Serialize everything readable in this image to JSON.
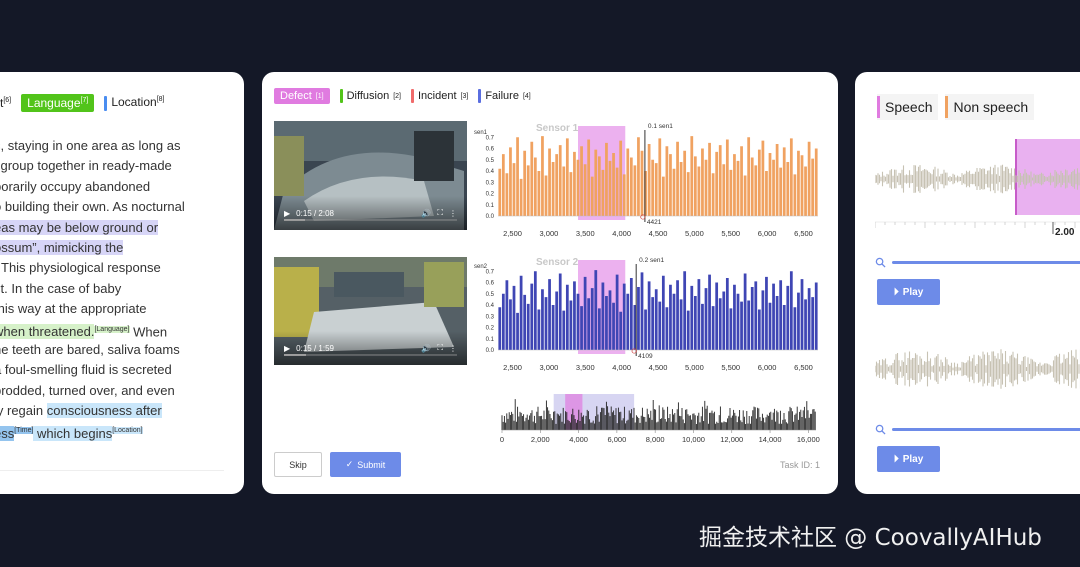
{
  "left_card": {
    "labels": [
      {
        "text": "ct",
        "sup": "[6]",
        "color": "#ffffff",
        "style": "plain"
      },
      {
        "text": "Language",
        "sup": "[7]",
        "color": "#52c41a",
        "style": "pill"
      },
      {
        "text": "Location",
        "sup": "[8]",
        "color": "#4a8df0",
        "style": "bar"
      }
    ],
    "lines": [
      [
        {
          "t": "c, staying in one area as long as"
        }
      ],
      [
        {
          "t": "l group together in ready-made"
        }
      ],
      [
        {
          "t": "porarily occupy abandoned"
        }
      ],
      [
        {
          "t": "o building their own. As nocturnal"
        }
      ],
      [
        {
          "t": "eas may be below ground or",
          "hl": "purple"
        }
      ],
      [
        {
          "t": "ossum”, mimicking the",
          "hl": "purple"
        }
      ],
      [
        {
          "t": "]",
          "hl": "purple"
        },
        {
          "t": "  This physiological response"
        }
      ],
      [
        {
          "t": "ct. In the case of baby"
        }
      ],
      [
        {
          "t": " this way at the appropriate"
        }
      ],
      [
        {
          "t": " when threatened.",
          "hl": "green"
        },
        {
          "t": "[Language]",
          "hl": "green",
          "sup": true
        },
        {
          "t": " When"
        }
      ],
      [
        {
          "t": "he teeth are bared, saliva foams"
        }
      ],
      [
        {
          "t": "a foul-smelling fluid is secreted"
        }
      ],
      [
        {
          "t": "prodded, turned over, and even"
        }
      ],
      [
        {
          "t": "ly regain "
        },
        {
          "t": "consciousness after",
          "hl": "blue"
        }
      ],
      [
        {
          "t": "ess",
          "hl": "blue-dark"
        },
        {
          "t": "[Time]",
          "hl": "blue-dark",
          "sup": true
        },
        {
          "t": " which begins",
          "hl": "blue"
        },
        {
          "t": "[Location]",
          "hl": "blue",
          "sup": true
        }
      ]
    ]
  },
  "middle_card": {
    "labels": [
      {
        "text": "Defect",
        "sup": "[1]",
        "color": "#e07be0"
      },
      {
        "text": "Diffusion",
        "sup": "[2]",
        "color": "#52c41a"
      },
      {
        "text": "Incident",
        "sup": "[3]",
        "color": "#f06b6b"
      },
      {
        "text": "Failure",
        "sup": "[4]",
        "color": "#5a6ee0"
      }
    ],
    "videos": [
      {
        "time": "0:15 / 2:08",
        "progress": 0.12
      },
      {
        "time": "0:15 / 1:59",
        "progress": 0.13
      }
    ],
    "skip_label": "Skip",
    "submit_label": "Submit",
    "task_id": "Task ID: 1"
  },
  "chart_data": [
    {
      "type": "bar",
      "title": "Sensor 1",
      "ylabel": "sen1",
      "color": "#f0a261",
      "xlim": [
        2300,
        6700
      ],
      "ylim": [
        0,
        0.8
      ],
      "yticks": [
        0.0,
        0.1,
        0.2,
        0.3,
        0.4,
        0.5,
        0.6,
        0.7
      ],
      "xticks": [
        2500,
        3000,
        3500,
        4000,
        4500,
        5000,
        5500,
        6000,
        6500
      ],
      "region": {
        "start": 3400,
        "end": 4050,
        "color": "#e9a3ec"
      },
      "marker": {
        "x": 4320,
        "label": "0.1 sen1",
        "value_label": "4421"
      },
      "values": [
        0.42,
        0.55,
        0.38,
        0.61,
        0.47,
        0.7,
        0.33,
        0.58,
        0.45,
        0.66,
        0.52,
        0.4,
        0.71,
        0.36,
        0.6,
        0.48,
        0.55,
        0.63,
        0.44,
        0.69,
        0.39,
        0.57,
        0.5,
        0.62,
        0.46,
        0.68,
        0.35,
        0.59,
        0.53,
        0.41,
        0.65,
        0.49,
        0.56,
        0.43,
        0.67,
        0.37,
        0.6,
        0.52,
        0.45,
        0.7,
        0.58,
        0.4,
        0.64,
        0.5,
        0.47,
        0.69,
        0.35,
        0.62,
        0.55,
        0.42,
        0.66,
        0.48,
        0.58,
        0.39,
        0.71,
        0.53,
        0.44,
        0.6,
        0.5,
        0.65,
        0.38,
        0.57,
        0.63,
        0.46,
        0.68,
        0.41,
        0.55,
        0.49,
        0.62,
        0.36,
        0.7,
        0.52,
        0.45,
        0.59,
        0.67,
        0.4,
        0.56,
        0.5,
        0.64,
        0.43,
        0.61,
        0.48,
        0.69,
        0.37,
        0.58,
        0.54,
        0.44,
        0.66,
        0.51,
        0.6
      ]
    },
    {
      "type": "bar",
      "title": "Sensor 2",
      "ylabel": "sen2",
      "color": "#3f46b4",
      "xlim": [
        2300,
        6700
      ],
      "ylim": [
        0,
        0.8
      ],
      "yticks": [
        0.0,
        0.1,
        0.2,
        0.3,
        0.4,
        0.5,
        0.6,
        0.7
      ],
      "xticks": [
        2500,
        3000,
        3500,
        4000,
        4500,
        5000,
        5500,
        6000,
        6500
      ],
      "region": {
        "start": 3400,
        "end": 4050,
        "color": "#e9a3ec"
      },
      "marker": {
        "x": 4200,
        "label": "0.2 sen1",
        "value_label": "4109"
      },
      "values": [
        0.38,
        0.5,
        0.62,
        0.45,
        0.57,
        0.33,
        0.66,
        0.49,
        0.41,
        0.59,
        0.7,
        0.36,
        0.54,
        0.47,
        0.63,
        0.4,
        0.52,
        0.68,
        0.35,
        0.58,
        0.44,
        0.61,
        0.5,
        0.39,
        0.65,
        0.46,
        0.55,
        0.71,
        0.37,
        0.6,
        0.48,
        0.53,
        0.42,
        0.67,
        0.34,
        0.59,
        0.5,
        0.64,
        0.4,
        0.56,
        0.69,
        0.36,
        0.61,
        0.47,
        0.54,
        0.43,
        0.66,
        0.38,
        0.58,
        0.5,
        0.62,
        0.45,
        0.7,
        0.35,
        0.57,
        0.48,
        0.63,
        0.41,
        0.55,
        0.67,
        0.39,
        0.6,
        0.46,
        0.52,
        0.64,
        0.37,
        0.58,
        0.5,
        0.43,
        0.68,
        0.44,
        0.56,
        0.61,
        0.36,
        0.53,
        0.65,
        0.42,
        0.59,
        0.48,
        0.62,
        0.4,
        0.57,
        0.7,
        0.38,
        0.51,
        0.63,
        0.45,
        0.55,
        0.47,
        0.6
      ]
    },
    {
      "type": "area",
      "title": "",
      "color": "#222222",
      "xlim": [
        0,
        16400
      ],
      "xticks": [
        0,
        2000,
        4000,
        6000,
        8000,
        10000,
        12000,
        14000,
        16000
      ],
      "window": {
        "start": 2700,
        "end": 6900,
        "color": "#d7d5f2"
      },
      "region": {
        "start": 3300,
        "end": 4200,
        "color": "#e07be0"
      }
    }
  ],
  "right_card": {
    "labels": [
      {
        "text": "Speech",
        "color": "#e07be0"
      },
      {
        "text": "Non speech",
        "color": "#f0a261"
      }
    ],
    "timestamp": "2.00",
    "play_label": "Play"
  },
  "watermark": "掘金技术社区 @ CoovallyAIHub"
}
